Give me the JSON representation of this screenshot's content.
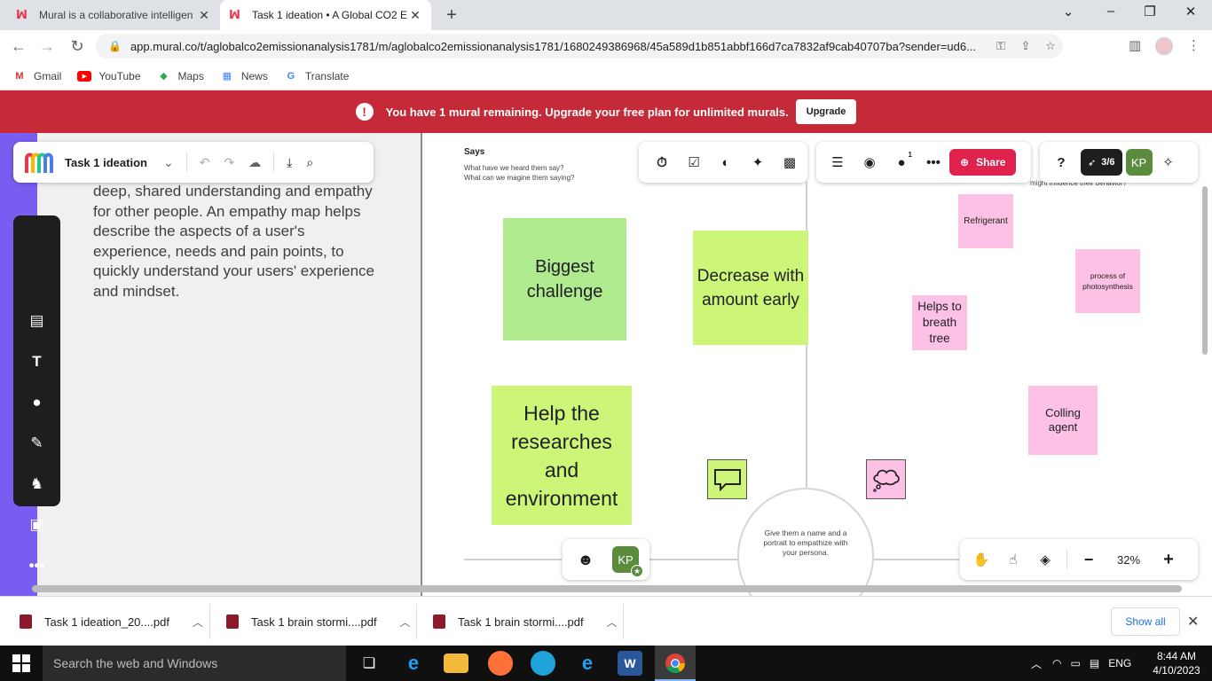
{
  "browser": {
    "tabs": [
      {
        "title": "Mural is a collaborative intelligen",
        "active": false
      },
      {
        "title": "Task 1 ideation • A Global CO2 E",
        "active": true
      }
    ],
    "url": "app.mural.co/t/aglobalco2emissionanalysis1781/m/aglobalco2emissionanalysis1781/1680249386968/45a589d1b851abbf166d7ca7832af9cab40707ba?sender=ud6...",
    "bookmarks": [
      "Gmail",
      "YouTube",
      "Maps",
      "News",
      "Translate"
    ]
  },
  "banner": {
    "message": "You have 1 mural remaining. Upgrade your free plan for unlimited murals.",
    "upgrade_label": "Upgrade"
  },
  "mural": {
    "board_title": "Task 1 ideation",
    "description": "deep, shared understanding and empathy for other people. An empathy map helps describe the aspects of a user's experience, needs and pain points, to quickly understand your users' experience and mindset.",
    "says_title": "Says",
    "says_subtitle_1": "What have we heard them say?",
    "says_subtitle_2": "What can we magine them saying?",
    "right_subtitle": "might influence their behavior?",
    "stickies": {
      "biggest": "Biggest challenge",
      "decrease": "Decrease with amount early",
      "help": "Help the researches and environment",
      "refrigerant": "Refrigerant",
      "photosynthesis": "process of photosynthesis",
      "breath": "Helps to breath tree",
      "colling": "Colling agent"
    },
    "persona_hint": "Give them a name and a portrait to empathize with your persona.",
    "share_label": "Share",
    "rocket_progress": "3/6",
    "user_initials": "KP",
    "notification_count": "1",
    "zoom": "32%"
  },
  "downloads": [
    {
      "name": "Task 1 ideation_20....pdf"
    },
    {
      "name": "Task 1 brain stormi....pdf"
    },
    {
      "name": "Task 1 brain stormi....pdf"
    }
  ],
  "downloads_show_all": "Show all",
  "taskbar": {
    "search_placeholder": "Search the web and Windows",
    "language": "ENG",
    "time": "8:44 AM",
    "date": "4/10/2023"
  },
  "colors": {
    "banner": "#c42a37",
    "share": "#e0224f",
    "sticky_green": "#b0ea8f",
    "sticky_lime": "#cdf577",
    "sticky_pink": "#fdc1e5",
    "purple": "#7b5cf0"
  }
}
